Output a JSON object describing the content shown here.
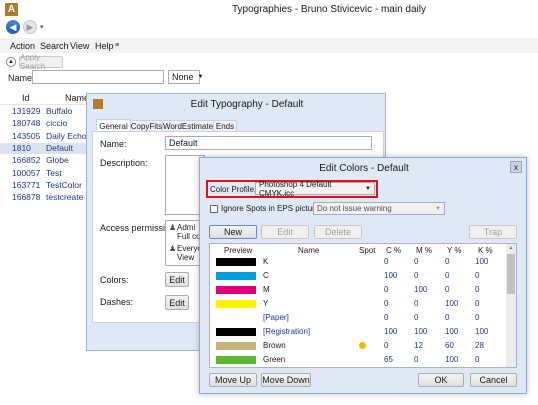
{
  "window": {
    "title": "Typographies - Bruno Stivicevic - main daily"
  },
  "menu": {
    "items": [
      "Action",
      "Search",
      "View",
      "Help"
    ]
  },
  "search": {
    "apply_label": "Apply Search",
    "name_label": "Name:",
    "name_value": "",
    "filter_value": "None"
  },
  "grid": {
    "headers": [
      "Id",
      "Name"
    ],
    "rows": [
      {
        "id": "131929",
        "name": "Buffalo"
      },
      {
        "id": "180748",
        "name": "ciccio"
      },
      {
        "id": "143505",
        "name": "Daily Echo"
      },
      {
        "id": "1810",
        "name": "Default"
      },
      {
        "id": "166852",
        "name": "Globe"
      },
      {
        "id": "100057",
        "name": "Test"
      },
      {
        "id": "163771",
        "name": "TestColor"
      },
      {
        "id": "166878",
        "name": "testcreate"
      }
    ]
  },
  "typography_dialog": {
    "title": "Edit Typography - Default",
    "tabs": [
      "General",
      "CopyFits",
      "WordEstimate",
      "Ends"
    ],
    "name_label": "Name:",
    "name_value": "Default",
    "description_label": "Description:",
    "access_label": "Access permissions:",
    "access_entries": [
      {
        "line1": "Admi",
        "line2": "Full co"
      },
      {
        "line1": "Everyo",
        "line2": "View"
      }
    ],
    "colors_label": "Colors:",
    "dashes_label": "Dashes:",
    "edit_label": "Edit"
  },
  "colors_dialog": {
    "title": "Edit Colors - Default",
    "close_label": "x",
    "profile_label": "Color Profile:",
    "profile_value": "Photoshop 4 Default CMYK.icc",
    "ignore_spots_label": "Ignore Spots in EPS pictures",
    "warning_value": "Do not issue warning",
    "buttons": {
      "new": "New",
      "edit": "Edit",
      "delete": "Delete",
      "trap": "Trap",
      "move_up": "Move Up",
      "move_down": "Move Down",
      "ok": "OK",
      "cancel": "Cancel"
    },
    "columns": [
      "Preview",
      "Name",
      "Spot",
      "C %",
      "M %",
      "Y %",
      "K %"
    ],
    "colors": [
      {
        "name": "K",
        "swatch": "#000000",
        "spot": false,
        "c": "0",
        "m": "0",
        "y": "0",
        "k": "100"
      },
      {
        "name": "C",
        "swatch": "#00a0e0",
        "spot": false,
        "c": "100",
        "m": "0",
        "y": "0",
        "k": "0"
      },
      {
        "name": "M",
        "swatch": "#e0007a",
        "spot": false,
        "c": "0",
        "m": "100",
        "y": "0",
        "k": "0"
      },
      {
        "name": "Y",
        "swatch": "#fff200",
        "spot": false,
        "c": "0",
        "m": "0",
        "y": "100",
        "k": "0"
      },
      {
        "name": "[Paper]",
        "swatch": null,
        "spot": false,
        "c": "0",
        "m": "0",
        "y": "0",
        "k": "0"
      },
      {
        "name": "[Registration]",
        "swatch": "#000000",
        "spot": false,
        "c": "100",
        "m": "100",
        "y": "100",
        "k": "100"
      },
      {
        "name": "Brown",
        "swatch": "#c8b47a",
        "spot": true,
        "c": "0",
        "m": "12",
        "y": "60",
        "k": "28"
      },
      {
        "name": "Green",
        "swatch": "#5cb830",
        "spot": false,
        "c": "65",
        "m": "0",
        "y": "100",
        "k": "0"
      }
    ]
  },
  "accent": {
    "highlight_red": "#e0101a",
    "link_blue": "#1f3a93",
    "spot_dot": "#f5b800"
  }
}
